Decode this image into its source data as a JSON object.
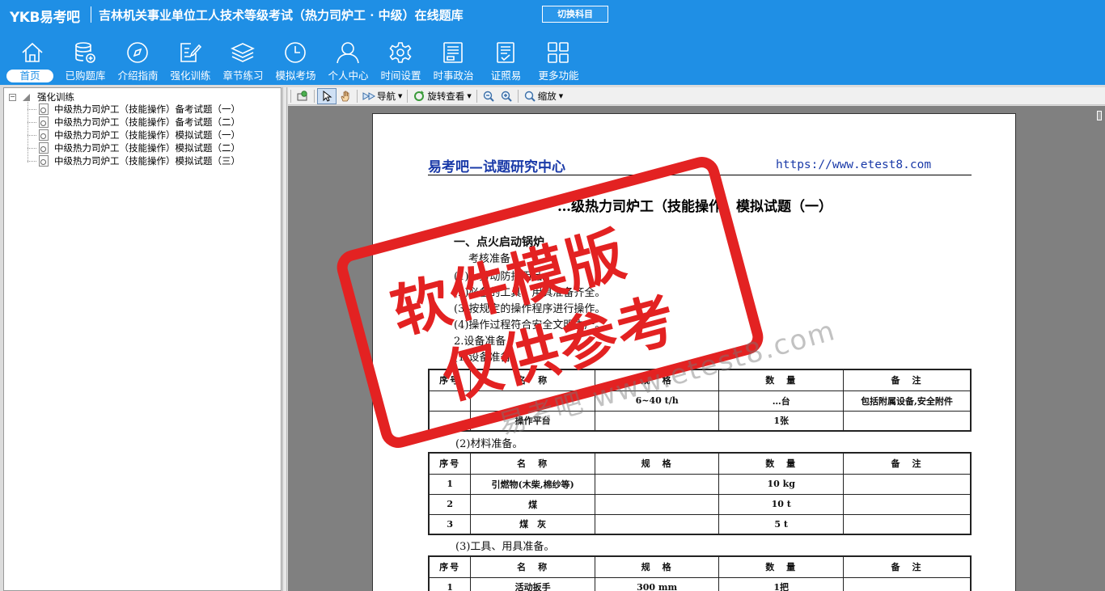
{
  "header": {
    "logo": "YKB易考吧",
    "title": "吉林机关事业单位工人技术等级考试（热力司炉工 · 中级）在线题库",
    "switch_subject": "切换科目"
  },
  "nav": {
    "items": [
      {
        "label": "首页",
        "icon": "home-icon",
        "active": true
      },
      {
        "label": "已购题库",
        "icon": "database-icon"
      },
      {
        "label": "介绍指南",
        "icon": "compass-icon"
      },
      {
        "label": "强化训练",
        "icon": "edit-icon"
      },
      {
        "label": "章节练习",
        "icon": "layers-icon"
      },
      {
        "label": "模拟考场",
        "icon": "clock-icon"
      },
      {
        "label": "个人中心",
        "icon": "user-icon"
      },
      {
        "label": "时间设置",
        "icon": "gear-icon"
      },
      {
        "label": "时事政治",
        "icon": "news-icon"
      },
      {
        "label": "证照易",
        "icon": "certificate-icon"
      },
      {
        "label": "更多功能",
        "icon": "grid-icon"
      }
    ]
  },
  "tree": {
    "root": "强化训练",
    "items": [
      "中级热力司炉工（技能操作）备考试题（一）",
      "中级热力司炉工（技能操作）备考试题（二）",
      "中级热力司炉工（技能操作）模拟试题（一）",
      "中级热力司炉工（技能操作）模拟试题（二）",
      "中级热力司炉工（技能操作）模拟试题（三）"
    ]
  },
  "toolbar": {
    "navigate": "导航",
    "rotate": "旋转查看",
    "zoom": "缩放"
  },
  "document": {
    "header_left": "易考吧—试题研究中心",
    "header_right": "https://www.etest8.com",
    "title": "…级热力司炉工（技能操作）模拟试题（一）",
    "lines": {
      "section": "一、点火启动锅炉",
      "prep": "考核准备",
      "l1": "(1)…劳动防护用品。",
      "l2": "(2)必备的工具、用具准备齐全。",
      "l3": "(3)按规定的操作程序进行操作。",
      "l4": "(4)操作过程符合安全文明生产。",
      "l5": "2.设备准备",
      "l6": "(1)设备准备。",
      "materials": "(2)材料准备。",
      "tools": "(3)工具、用具准备。"
    },
    "table_headers": {
      "no": "序号",
      "name": "名　称",
      "spec": "规　格",
      "qty": "数　量",
      "remark": "备　注"
    },
    "table1_rows": [
      {
        "no": "",
        "name": "",
        "spec": "6~40 t/h",
        "qty": "…台",
        "remark": "包括附属设备,安全附件"
      },
      {
        "no": "",
        "name": "操作平台",
        "spec": "",
        "qty": "1张",
        "remark": ""
      }
    ],
    "table2_rows": [
      {
        "no": "1",
        "name": "引燃物(木柴,棉纱等)",
        "spec": "",
        "qty": "10 kg",
        "remark": ""
      },
      {
        "no": "2",
        "name": "煤",
        "spec": "",
        "qty": "10 t",
        "remark": ""
      },
      {
        "no": "3",
        "name": "煤　灰",
        "spec": "",
        "qty": "5 t",
        "remark": ""
      }
    ],
    "table3_rows": [
      {
        "no": "1",
        "name": "活动扳手",
        "spec": "300 mm",
        "qty": "1把",
        "remark": ""
      }
    ]
  },
  "stamp": {
    "line1": "软件模版",
    "line2": "仅供参考"
  },
  "watermark": "易考吧 www.etest8.com",
  "colors": {
    "header_bg": "#1f8fe5",
    "stamp_red": "#e32222",
    "doc_blue": "#1a3aa8",
    "viewer_bg": "#808080"
  }
}
